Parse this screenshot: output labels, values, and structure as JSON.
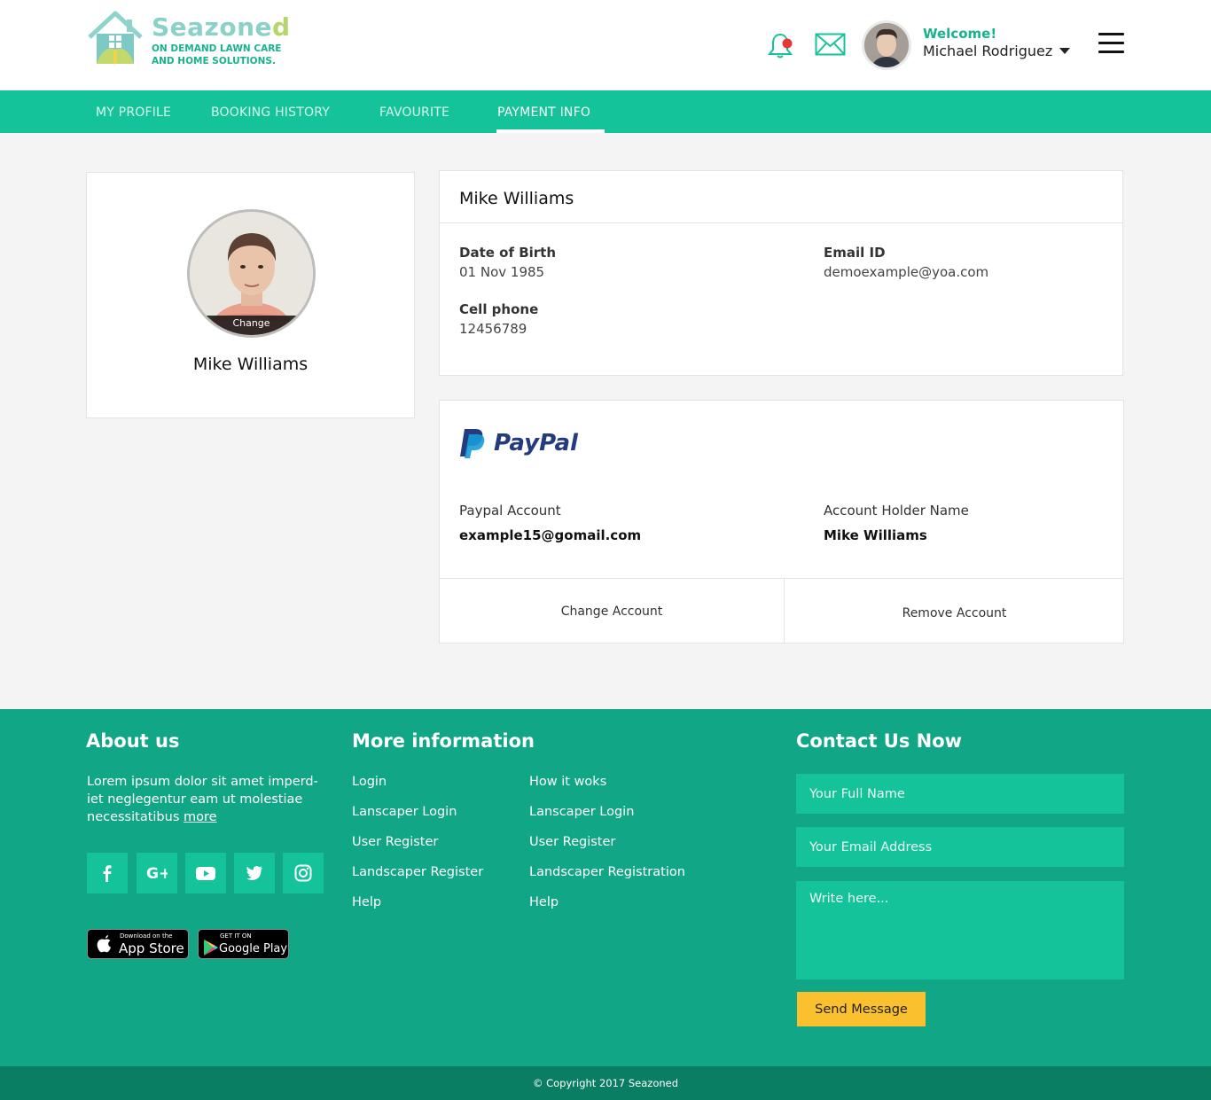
{
  "brand": {
    "name_main": "Seazone",
    "name_tail": "d",
    "tagline_1": "ON DEMAND LAWN CARE",
    "tagline_2": "AND HOME SOLUTIONS."
  },
  "header": {
    "welcome": "Welcome!",
    "username": "Michael Rodriguez"
  },
  "nav": {
    "items": [
      "MY PROFILE",
      "BOOKING HISTORY",
      "FAVOURITE",
      "PAYMENT INFO"
    ],
    "active": "PAYMENT INFO"
  },
  "profile": {
    "change_label": "Change",
    "name": "Mike Williams"
  },
  "info": {
    "title": "Mike Williams",
    "dob_label": "Date of Birth",
    "dob_value": "01 Nov 1985",
    "email_label": "Email ID",
    "email_value": "demoexample@yoa.com",
    "phone_label": "Cell phone",
    "phone_value": "12456789"
  },
  "payment": {
    "provider": "PayPal",
    "account_label": "Paypal Account",
    "account_value": "example15@gomail.com",
    "holder_label": "Account Holder Name",
    "holder_value": "Mike Williams",
    "change_button": "Change Account",
    "remove_button": "Remove Account"
  },
  "footer": {
    "about_heading": "About us",
    "about_text": "Lorem ipsum dolor sit amet imperd-iet neglegentur eam ut molestiae necessitatibus",
    "about_more": "more",
    "social": [
      "facebook-icon",
      "google-plus-icon",
      "youtube-icon",
      "twitter-icon",
      "instagram-icon"
    ],
    "appstore_small": "Download on the",
    "appstore_big": "App Store",
    "googleplay_small": "GET IT ON",
    "googleplay_big": "Google Play",
    "more_heading": "More information",
    "links_col1": [
      "Login",
      "Lanscaper Login",
      "User Register",
      "Landscaper Register",
      "Help"
    ],
    "links_col2": [
      "How it woks",
      "Lanscaper Login",
      "User Register",
      "Landscaper Registration",
      "Help"
    ],
    "contact_heading": "Contact Us Now",
    "name_placeholder": "Your Full Name",
    "email_placeholder": "Your Email Address",
    "message_placeholder": "Write here...",
    "send_label": "Send Message",
    "copyright": "© Copyright 2017 Seazoned"
  },
  "colors": {
    "accent": "#15c39a",
    "footer": "#10a686",
    "footer_bottom": "#0a7e63",
    "send_button": "#fbc02d"
  }
}
